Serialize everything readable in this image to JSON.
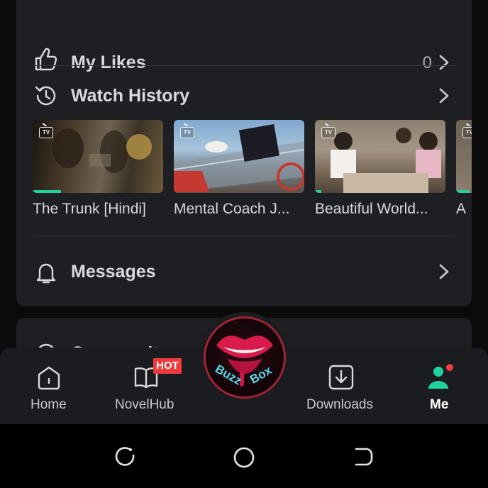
{
  "menu": {
    "likes": {
      "label": "My Likes",
      "count": "0",
      "icon": "thumbs-up-icon"
    },
    "history": {
      "label": "Watch History",
      "icon": "history-clock-icon"
    },
    "messages": {
      "label": "Messages",
      "icon": "bell-icon"
    }
  },
  "history_items": [
    {
      "title": "The Trunk [Hindi]",
      "badge": "TV",
      "progress": 0.22
    },
    {
      "title": "Mental Coach J...",
      "badge": "TV",
      "progress": 0
    },
    {
      "title": "Beautiful World...",
      "badge": "TV",
      "progress": 0.05
    },
    {
      "title": "A",
      "badge": "TV",
      "progress": 0.1
    }
  ],
  "second_card": {
    "partial_label": "Community"
  },
  "nav": {
    "home": "Home",
    "novelhub": "NovelHub",
    "hot_badge": "HOT",
    "logo": "Buzz Box",
    "logo_line1": "Buzz",
    "logo_line2": "Box",
    "downloads": "Downloads",
    "me": "Me"
  },
  "colors": {
    "accent": "#1ed3a0",
    "hot": "#ef3b3b",
    "background": "#0b0b0c",
    "card": "#1e1f23",
    "notification_dot": "#ef3b3b"
  }
}
